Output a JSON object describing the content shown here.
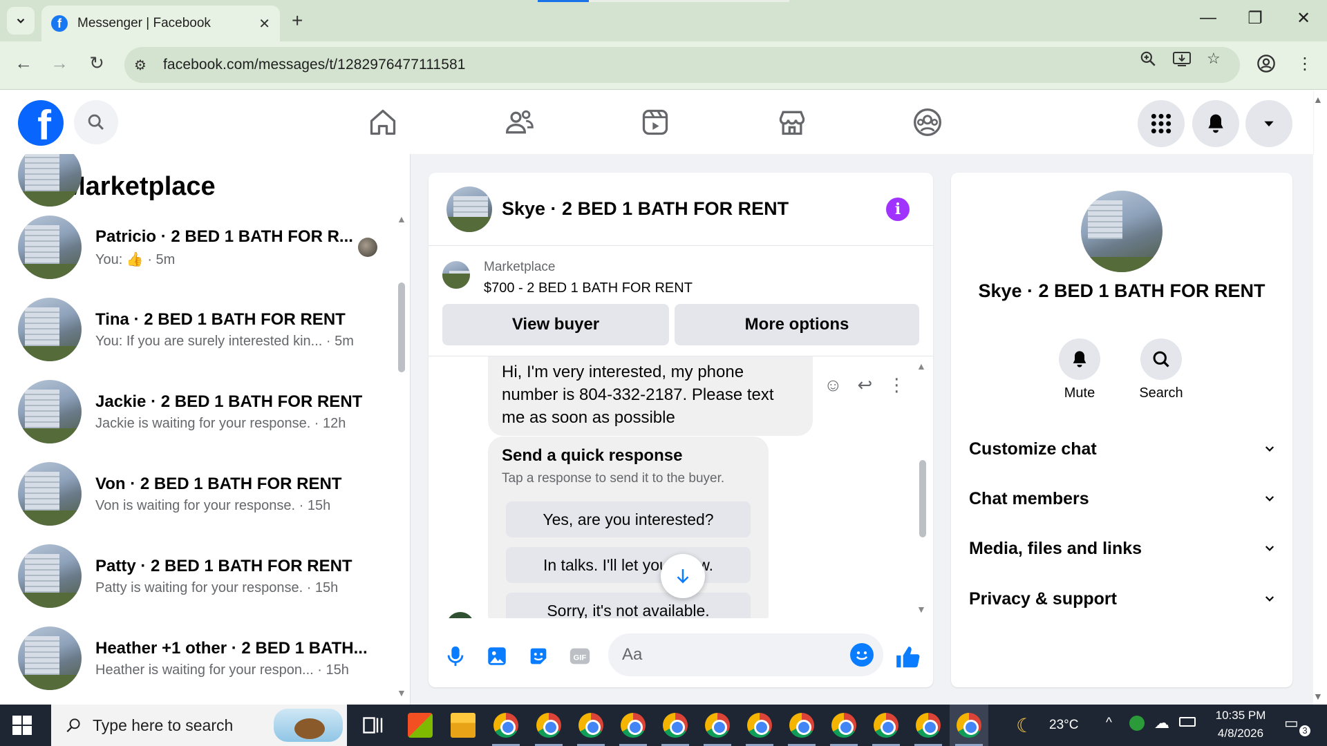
{
  "browser": {
    "tab_title": "Messenger | Facebook",
    "new_tab": "+",
    "url": "facebook.com/messages/t/1282976477111581"
  },
  "marketplace_list": {
    "title": "Marketplace",
    "conversations": [
      {
        "name": "Patricio · 2 BED 1 BATH FOR R...",
        "preview": "You: 👍 · 5m"
      },
      {
        "name": "Tina · 2 BED 1 BATH FOR RENT",
        "preview": "You: If you are surely interested kin... · 5m"
      },
      {
        "name": "Jackie · 2 BED 1 BATH FOR RENT",
        "preview": "Jackie is waiting for your response. · 12h"
      },
      {
        "name": "Von · 2 BED 1 BATH FOR RENT",
        "preview": "Von is waiting for your response. · 15h"
      },
      {
        "name": "Patty · 2 BED 1 BATH FOR RENT",
        "preview": "Patty is waiting for your response. · 15h"
      },
      {
        "name": "Heather +1 other · 2 BED 1 BATH...",
        "preview": "Heather is waiting for your respon... · 15h"
      }
    ]
  },
  "chat": {
    "title": "Skye · 2 BED 1 BATH FOR RENT",
    "marketplace_label": "Marketplace",
    "listing": "$700 - 2 BED 1 BATH FOR RENT",
    "view_buyer": "View buyer",
    "more_options": "More options",
    "message": "Hi, I'm very interested, my phone number is 804-332-2187. Please text me as soon as possible",
    "quick_title": "Send a quick response",
    "quick_subtitle": "Tap a response to send it to the buyer.",
    "quick_options": [
      "Yes, are you interested?",
      "In talks. I'll let you know.",
      "Sorry, it's not available."
    ],
    "input_placeholder": "Aa"
  },
  "details": {
    "name": "Skye · 2 BED 1 BATH FOR RENT",
    "mute": "Mute",
    "search": "Search",
    "sections": [
      "Customize chat",
      "Chat members",
      "Media, files and links",
      "Privacy & support"
    ]
  },
  "taskbar": {
    "search_placeholder": "Type here to search",
    "temperature": "23°C",
    "time": "10:35 PM",
    "date": "4/8/2026",
    "notifications": "3"
  },
  "colors": {
    "fb_blue": "#0866ff",
    "messenger_blue": "#0a7cff",
    "info_purple": "#a033ff"
  }
}
